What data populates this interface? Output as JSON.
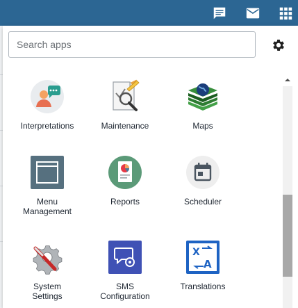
{
  "header": {
    "icons": [
      "message-icon",
      "mail-icon",
      "apps-grid-icon"
    ]
  },
  "search": {
    "placeholder": "Search apps",
    "value": ""
  },
  "settings_icon": "gear-icon",
  "apps": [
    {
      "label": "Interpretations",
      "icon": "interpretations-icon"
    },
    {
      "label": "Maintenance",
      "icon": "maintenance-icon"
    },
    {
      "label": "Maps",
      "icon": "maps-icon"
    },
    {
      "label": "Menu\nManagement",
      "icon": "menu-management-icon"
    },
    {
      "label": "Reports",
      "icon": "reports-icon"
    },
    {
      "label": "Scheduler",
      "icon": "scheduler-icon"
    },
    {
      "label": "System\nSettings",
      "icon": "system-settings-icon"
    },
    {
      "label": "SMS\nConfiguration",
      "icon": "sms-configuration-icon"
    },
    {
      "label": "Translations",
      "icon": "translations-icon"
    }
  ],
  "colors": {
    "header": "#2c6693",
    "label": "#212934",
    "scroll_thumb": "#a8a8a8"
  }
}
